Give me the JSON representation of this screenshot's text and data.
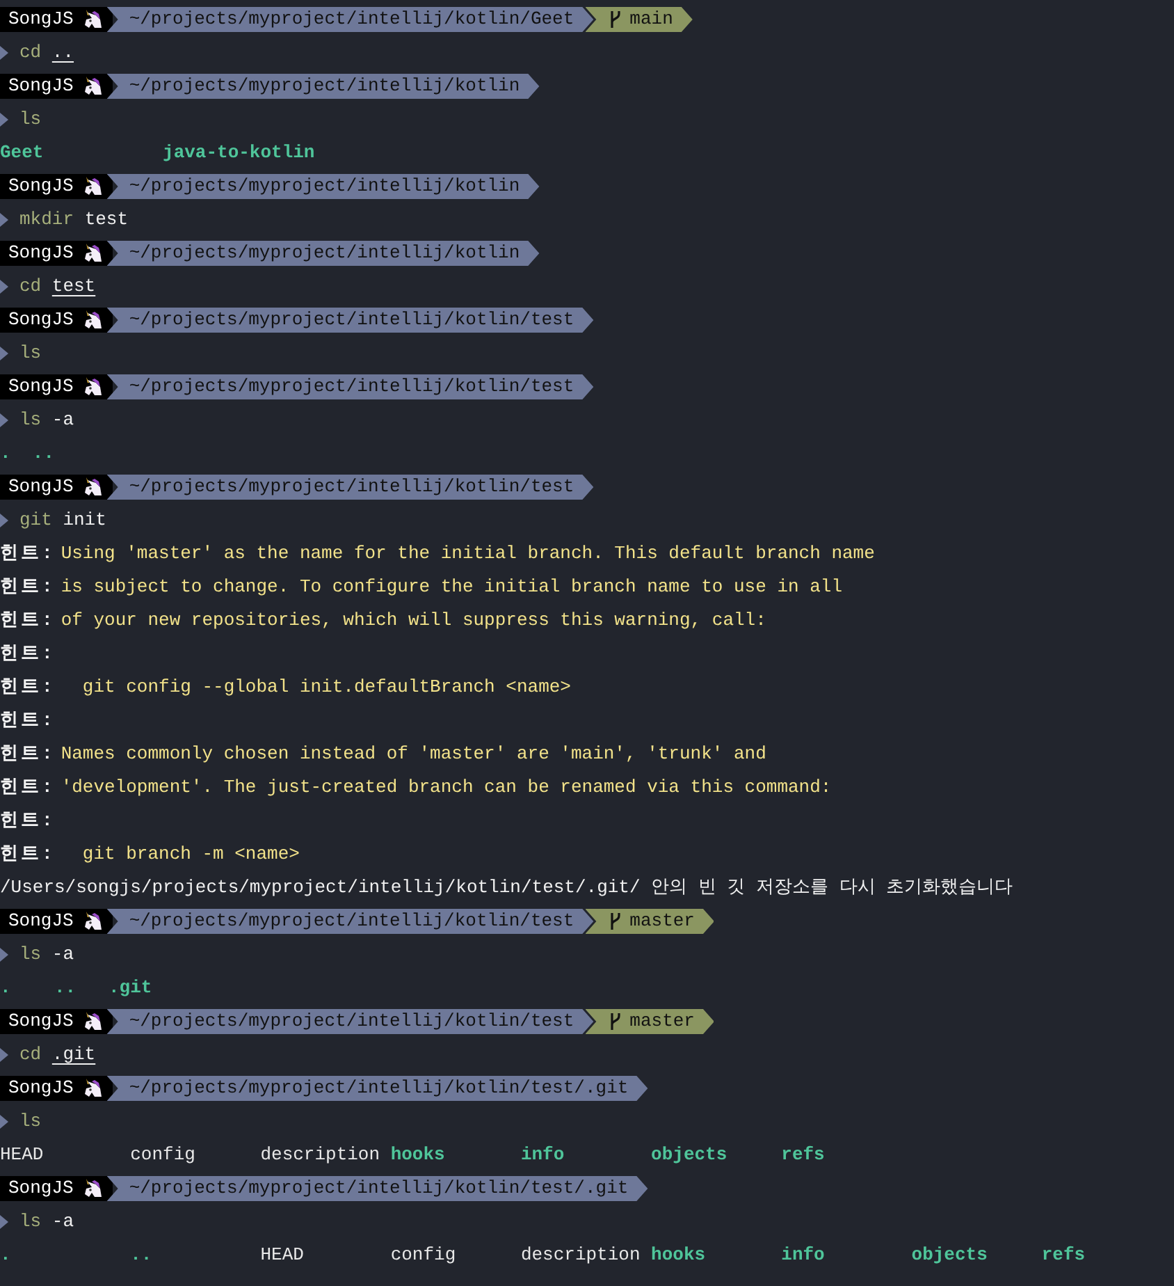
{
  "lines": [
    {
      "kind": "prompt",
      "user": "SongJS",
      "path": "~/projects/myproject/intellij/kotlin/Geet",
      "branch": "main"
    },
    {
      "kind": "command",
      "parts": [
        {
          "text": "cd",
          "kind": "program",
          "underline": false
        },
        {
          "text": "..",
          "kind": "arg",
          "underline": true
        }
      ]
    },
    {
      "kind": "prompt",
      "user": "SongJS",
      "path": "~/projects/myproject/intellij/kotlin"
    },
    {
      "kind": "command",
      "parts": [
        {
          "text": "ls",
          "kind": "program",
          "underline": false
        }
      ]
    },
    {
      "kind": "listing",
      "items": [
        {
          "text": "Geet",
          "dir": true
        },
        {
          "text": "java-to-kotlin",
          "dir": true
        }
      ]
    },
    {
      "kind": "prompt",
      "user": "SongJS",
      "path": "~/projects/myproject/intellij/kotlin"
    },
    {
      "kind": "command",
      "parts": [
        {
          "text": "mkdir",
          "kind": "program",
          "underline": false
        },
        {
          "text": "test",
          "kind": "arg",
          "underline": false
        }
      ]
    },
    {
      "kind": "prompt",
      "user": "SongJS",
      "path": "~/projects/myproject/intellij/kotlin"
    },
    {
      "kind": "command",
      "parts": [
        {
          "text": "cd",
          "kind": "program",
          "underline": false
        },
        {
          "text": "test",
          "kind": "arg",
          "underline": true
        }
      ]
    },
    {
      "kind": "prompt",
      "user": "SongJS",
      "path": "~/projects/myproject/intellij/kotlin/test"
    },
    {
      "kind": "command",
      "parts": [
        {
          "text": "ls",
          "kind": "program",
          "underline": false
        }
      ]
    },
    {
      "kind": "prompt",
      "user": "SongJS",
      "path": "~/projects/myproject/intellij/kotlin/test"
    },
    {
      "kind": "command",
      "parts": [
        {
          "text": "ls",
          "kind": "program",
          "underline": false
        },
        {
          "text": "-a",
          "kind": "arg",
          "underline": false
        }
      ]
    },
    {
      "kind": "listing",
      "items": [
        {
          "text": ".",
          "dir": true
        },
        {
          "text": "..",
          "dir": true
        }
      ]
    },
    {
      "kind": "prompt",
      "user": "SongJS",
      "path": "~/projects/myproject/intellij/kotlin/test"
    },
    {
      "kind": "command",
      "parts": [
        {
          "text": "git",
          "kind": "program",
          "underline": false
        },
        {
          "text": "init",
          "kind": "arg",
          "underline": false
        }
      ]
    },
    {
      "kind": "hint",
      "label": "힌트:",
      "text": "Using 'master' as the name for the initial branch. This default branch name"
    },
    {
      "kind": "hint",
      "label": "힌트:",
      "text": "is subject to change. To configure the initial branch name to use in all"
    },
    {
      "kind": "hint",
      "label": "힌트:",
      "text": "of your new repositories, which will suppress this warning, call:"
    },
    {
      "kind": "hint",
      "label": "힌트:"
    },
    {
      "kind": "hint",
      "label": "힌트:",
      "text": "  git config --global init.defaultBranch <name>"
    },
    {
      "kind": "hint",
      "label": "힌트:"
    },
    {
      "kind": "hint",
      "label": "힌트:",
      "text": "Names commonly chosen instead of 'master' are 'main', 'trunk' and"
    },
    {
      "kind": "hint",
      "label": "힌트:",
      "text": "'development'. The just-created branch can be renamed via this command:"
    },
    {
      "kind": "hint",
      "label": "힌트:"
    },
    {
      "kind": "hint",
      "label": "힌트:",
      "text": "  git branch -m <name>"
    },
    {
      "kind": "message",
      "text": "/Users/songjs/projects/myproject/intellij/kotlin/test/.git/ 안의 빈 깃 저장소를 다시 초기화했습니다"
    },
    {
      "kind": "prompt",
      "user": "SongJS",
      "path": "~/projects/myproject/intellij/kotlin/test",
      "branch": "master"
    },
    {
      "kind": "command",
      "parts": [
        {
          "text": "ls",
          "kind": "program",
          "underline": false
        },
        {
          "text": "-a",
          "kind": "arg",
          "underline": false
        }
      ]
    },
    {
      "kind": "listing",
      "items": [
        {
          "text": ".",
          "dir": true
        },
        {
          "text": "..",
          "dir": true
        },
        {
          "text": ".git",
          "dir": true
        }
      ]
    },
    {
      "kind": "prompt",
      "user": "SongJS",
      "path": "~/projects/myproject/intellij/kotlin/test",
      "branch": "master"
    },
    {
      "kind": "command",
      "parts": [
        {
          "text": "cd",
          "kind": "program",
          "underline": false
        },
        {
          "text": ".git",
          "kind": "arg",
          "underline": true
        }
      ]
    },
    {
      "kind": "prompt",
      "user": "SongJS",
      "path": "~/projects/myproject/intellij/kotlin/test/.git"
    },
    {
      "kind": "command",
      "parts": [
        {
          "text": "ls",
          "kind": "program",
          "underline": false
        }
      ]
    },
    {
      "kind": "listing",
      "items": [
        {
          "text": "HEAD",
          "dir": false
        },
        {
          "text": "config",
          "dir": false
        },
        {
          "text": "description",
          "dir": false
        },
        {
          "text": "hooks",
          "dir": true
        },
        {
          "text": "info",
          "dir": true
        },
        {
          "text": "objects",
          "dir": true
        },
        {
          "text": "refs",
          "dir": true
        }
      ]
    },
    {
      "kind": "prompt",
      "user": "SongJS",
      "path": "~/projects/myproject/intellij/kotlin/test/.git"
    },
    {
      "kind": "command",
      "parts": [
        {
          "text": "ls",
          "kind": "program",
          "underline": false
        },
        {
          "text": "-a",
          "kind": "arg",
          "underline": false
        }
      ]
    },
    {
      "kind": "listing",
      "items": [
        {
          "text": ".",
          "dir": true
        },
        {
          "text": "..",
          "dir": true
        },
        {
          "text": "HEAD",
          "dir": false
        },
        {
          "text": "config",
          "dir": false
        },
        {
          "text": "description",
          "dir": false
        },
        {
          "text": "hooks",
          "dir": true
        },
        {
          "text": "info",
          "dir": true
        },
        {
          "text": "objects",
          "dir": true
        },
        {
          "text": "refs",
          "dir": true
        }
      ]
    }
  ]
}
